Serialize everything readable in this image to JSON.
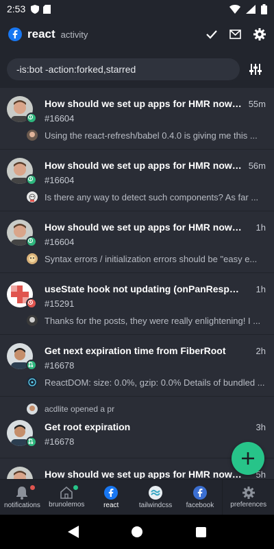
{
  "status_bar": {
    "time": "2:53"
  },
  "header": {
    "title": "react",
    "subtitle": "activity"
  },
  "filter": {
    "query": "-is:bot -action:forked,starred"
  },
  "items": [
    {
      "title": "How should we set up apps for HMR now t...",
      "number": "#16604",
      "time": "55m",
      "snippet": "Using the react-refresh/babel 0.4.0 is giving me this ..."
    },
    {
      "title": "How should we set up apps for HMR now t...",
      "number": "#16604",
      "time": "56m",
      "snippet": "Is there any way to detect such components? As far ..."
    },
    {
      "title": "How should we set up apps for HMR now tha...",
      "number": "#16604",
      "time": "1h",
      "snippet": "Syntax errors / initialization errors should be \"easy e..."
    },
    {
      "title": "useState hook not updating (onPanRespond...",
      "number": "#15291",
      "time": "1h",
      "snippet": "Thanks for the posts, they were really enlightening! I ..."
    },
    {
      "title": "Get next expiration time from FiberRoot",
      "number": "#16678",
      "time": "2h",
      "snippet": "ReactDOM: size: 0.0%, gzip: 0.0% Details of bundled ..."
    },
    {
      "actor_line": "acdlite opened a pr",
      "title": "Get root expiration",
      "number": "#16678",
      "time": "3h"
    },
    {
      "title": "How should we set up apps for HMR now tha...",
      "time": "5h"
    }
  ],
  "nav": {
    "notifications": "notifications",
    "brunolemos": "brunolemos",
    "react": "react",
    "tailwindcss": "tailwindcss",
    "facebook": "facebook",
    "preferences": "preferences"
  },
  "colors": {
    "background": "#2a2d36",
    "header": "#22252d",
    "accent_green": "#27c489",
    "issue_open": "#2eb67d",
    "badge_red": "#e0554f",
    "facebook_blue": "#1877f2"
  },
  "icons": {
    "header": [
      "facebook-icon",
      "check-icon",
      "mail-icon",
      "gear-icon"
    ],
    "filter": "sliders-icon",
    "fab": "plus-icon",
    "nav": [
      "bell-icon",
      "home-icon",
      "facebook-icon",
      "tailwind-icon",
      "facebook-icon",
      "gear-icon"
    ]
  }
}
